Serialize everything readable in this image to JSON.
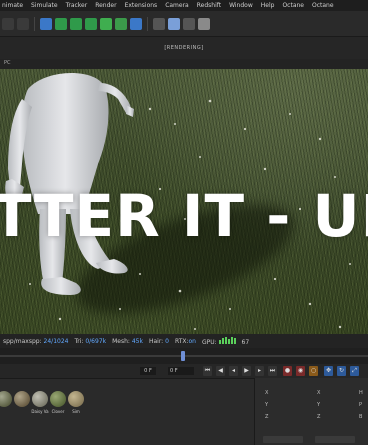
{
  "menu": {
    "items": [
      "nimate",
      "Simulate",
      "Tracker",
      "Render",
      "Extensions",
      "Camera",
      "Redshift",
      "Window",
      "Help",
      "Octane",
      "Octane"
    ]
  },
  "viewport": {
    "title": "[RENDERING]",
    "sub_label": "PC",
    "overlay_text": "TTER IT - UPD"
  },
  "status": {
    "spp_label": "spp/maxspp:",
    "spp_value": "24/1024",
    "tri_label": "Tri:",
    "tri_value": "0/697k",
    "mesh_label": "Mesh:",
    "mesh_value": "45k",
    "hair_label": "Hair:",
    "hair_value": "0",
    "rtx_label": "RTX:",
    "rtx_value": "on",
    "gpu_label": "GPU:",
    "gpu_value": "67",
    "gpu_bar_color": "#5bd15b"
  },
  "transport": {
    "frame_start": "0 F",
    "frame_current": "0 F"
  },
  "materials": [
    {
      "label": "",
      "color": "#5d6145"
    },
    {
      "label": "",
      "color": "#6b5e45"
    },
    {
      "label": "Daisy Va",
      "color": "#7d7c6d"
    },
    {
      "label": "Clover",
      "color": "#5b6a3c"
    },
    {
      "label": "Sim",
      "color": "#8a7d5c"
    }
  ],
  "coords": {
    "axes_left": [
      "X",
      "Y",
      "Z"
    ],
    "axes_mid": [
      "X",
      "Y",
      "Z"
    ],
    "axes_right": [
      "H",
      "P",
      "B"
    ]
  }
}
